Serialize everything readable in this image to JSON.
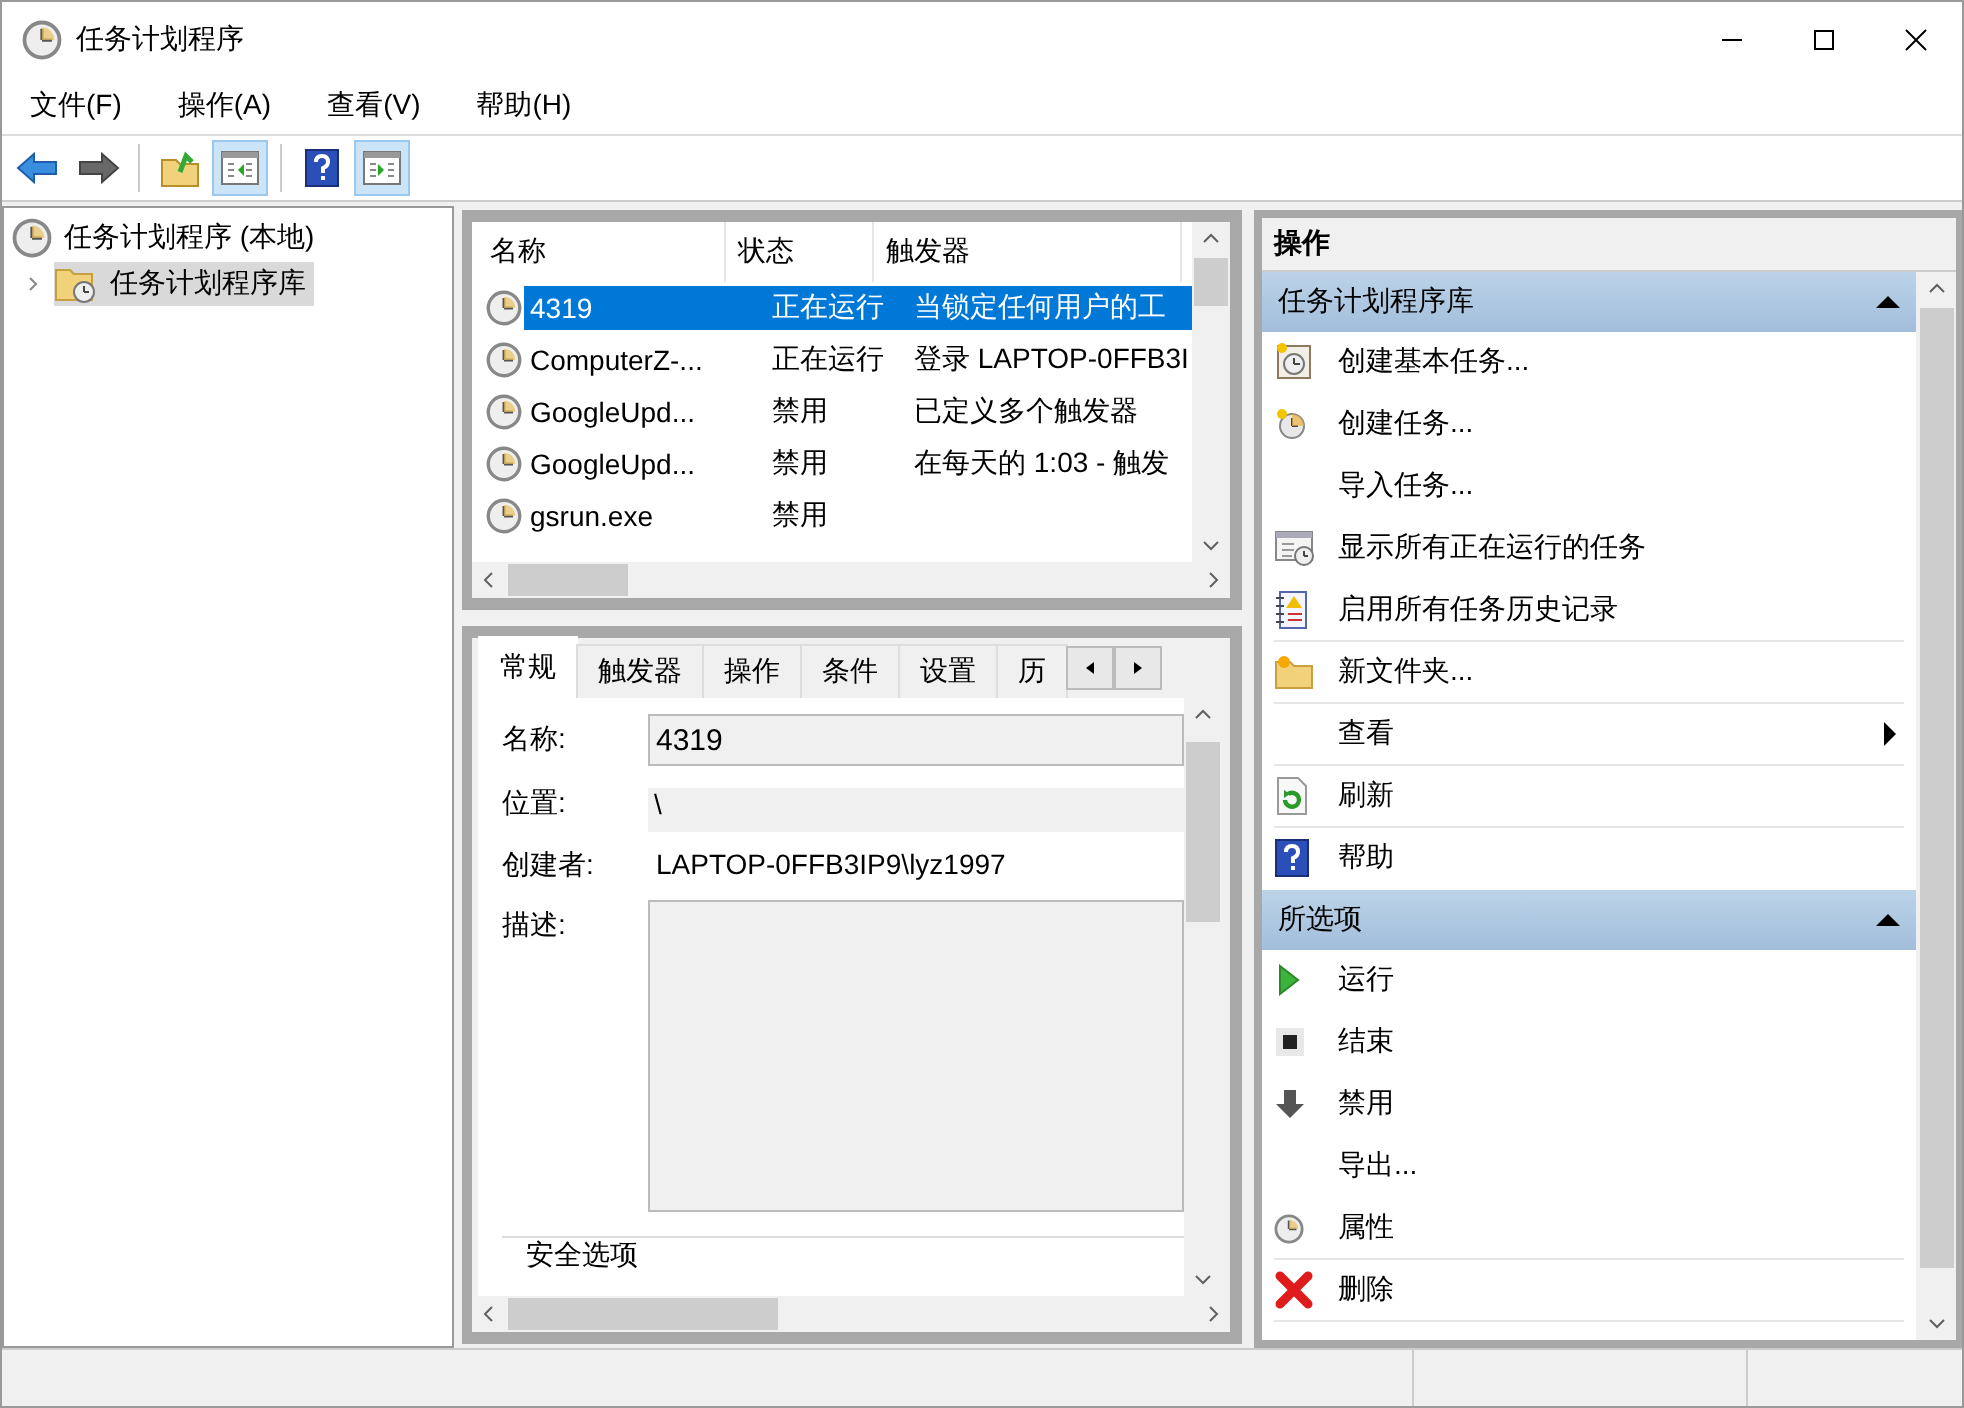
{
  "window": {
    "title": "任务计划程序"
  },
  "menu": [
    "文件(F)",
    "操作(A)",
    "查看(V)",
    "帮助(H)"
  ],
  "toolbar": [
    {
      "kind": "back",
      "on": false,
      "disabled": false
    },
    {
      "kind": "forward",
      "on": false,
      "disabled": true
    },
    {
      "kind": "up",
      "on": false,
      "disabled": false
    },
    {
      "kind": "tree-pane",
      "on": true,
      "disabled": false
    },
    {
      "kind": "help",
      "on": false,
      "disabled": false
    },
    {
      "kind": "action-pane",
      "on": true,
      "disabled": false
    }
  ],
  "tree": [
    {
      "label": "任务计划程序 (本地)",
      "selected": false,
      "children": [
        {
          "label": "任务计划程序库",
          "selected": true,
          "expanded": false
        }
      ]
    }
  ],
  "task_table": {
    "columns": [
      "名称",
      "状态",
      "触发器"
    ],
    "rows": [
      {
        "name": "4319",
        "status": "正在运行",
        "trigger": "当锁定任何用户的工",
        "selected": true
      },
      {
        "name": "ComputerZ-...",
        "status": "正在运行",
        "trigger": "登录 LAPTOP-0FFB3I",
        "selected": false
      },
      {
        "name": "GoogleUpd...",
        "status": "禁用",
        "trigger": "已定义多个触发器",
        "selected": false
      },
      {
        "name": "GoogleUpd...",
        "status": "禁用",
        "trigger": "在每天的 1:03 - 触发",
        "selected": false
      },
      {
        "name": "gsrun.exe",
        "status": "禁用",
        "selected": false
      }
    ]
  },
  "detail": {
    "tabs": [
      {
        "label": "常规",
        "selected": true
      },
      {
        "label": "触发器",
        "selected": false
      },
      {
        "label": "操作",
        "selected": false
      },
      {
        "label": "条件",
        "selected": false
      },
      {
        "label": "设置",
        "selected": false
      },
      {
        "label": "历",
        "selected": false
      }
    ],
    "fields": [
      {
        "kind": "input",
        "label": "名称:",
        "value": "4319"
      },
      {
        "kind": "readonly",
        "label": "位置:",
        "value": "\\"
      },
      {
        "kind": "text",
        "label": "创建者:",
        "value": "LAPTOP-0FFB3IP9\\lyz1997"
      },
      {
        "kind": "textarea",
        "label": "描述:"
      }
    ],
    "group_label": "安全选项"
  },
  "actions": {
    "title": "操作",
    "sections": [
      {
        "title": "任务计划程序库",
        "expanded": true,
        "items": [
          {
            "label": "创建基本任务...",
            "kind": "create-basic",
            "submenu": false,
            "separator_after": false
          },
          {
            "label": "创建任务...",
            "kind": "create",
            "submenu": false,
            "separator_after": false
          },
          {
            "label": "导入任务...",
            "kind": "plain",
            "submenu": false,
            "separator_after": false
          },
          {
            "label": "显示所有正在运行的任务",
            "kind": "running",
            "submenu": false,
            "separator_after": false
          },
          {
            "label": "启用所有任务历史记录",
            "kind": "history",
            "submenu": false,
            "separator_after": true
          },
          {
            "label": "新文件夹...",
            "kind": "folder",
            "submenu": false,
            "separator_after": true
          },
          {
            "label": "查看",
            "kind": "plain",
            "submenu": true,
            "separator_after": true
          },
          {
            "label": "刷新",
            "kind": "refresh",
            "submenu": false,
            "separator_after": true
          },
          {
            "label": "帮助",
            "kind": "help",
            "submenu": false,
            "separator_after": false
          }
        ]
      },
      {
        "title": "所选项",
        "expanded": true,
        "items": [
          {
            "label": "运行",
            "kind": "run",
            "submenu": false,
            "separator_after": false
          },
          {
            "label": "结束",
            "kind": "stop",
            "submenu": false,
            "separator_after": false
          },
          {
            "label": "禁用",
            "kind": "disable",
            "submenu": false,
            "separator_after": false
          },
          {
            "label": "导出...",
            "kind": "plain",
            "submenu": false,
            "separator_after": false
          },
          {
            "label": "属性",
            "kind": "properties",
            "submenu": false,
            "separator_after": true
          },
          {
            "label": "删除",
            "kind": "delete",
            "submenu": false,
            "separator_after": true
          }
        ]
      }
    ]
  }
}
